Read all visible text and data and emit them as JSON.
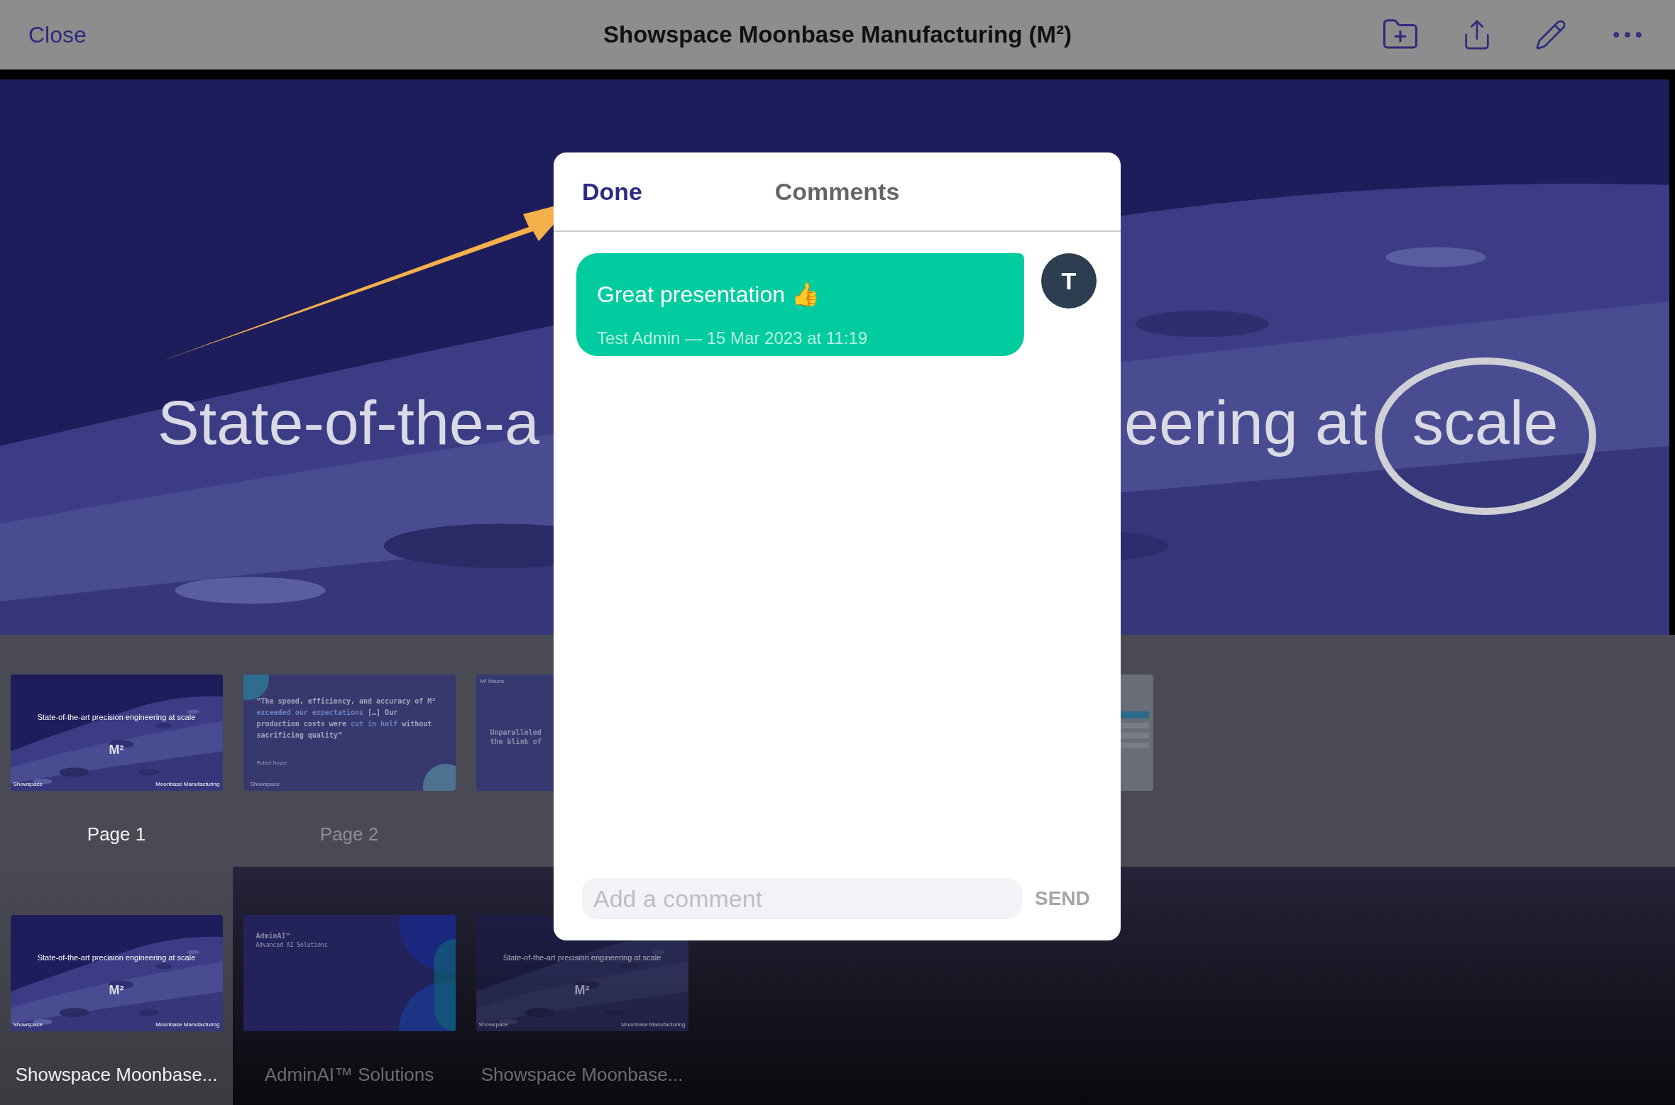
{
  "top_bar": {
    "close": "Close",
    "title": "Showspace Moonbase Manufacturing (M²)"
  },
  "slide": {
    "title_left": "State-of-the-a",
    "title_right": "eering at",
    "title_circled": "scale"
  },
  "pages": [
    {
      "label": "Page 1",
      "selected": true,
      "thumbnail": {
        "kind": "moon",
        "title": "State-of-the-art precision engineering at scale",
        "mark": "M²",
        "logo": "Showspace",
        "footer": "Moonbase Manufacturing"
      }
    },
    {
      "label": "Page 2",
      "selected": false,
      "thumbnail": {
        "kind": "quote",
        "quote": [
          {
            "text": "“The speed, efficiency, and accuracy of M² ",
            "highlight": false
          },
          {
            "text": "exceeded our expectations",
            "highlight": true
          },
          {
            "text": " […] Our production costs were ",
            "highlight": false
          },
          {
            "text": "cut in half",
            "highlight": true
          },
          {
            "text": " without sacrificing quality”",
            "highlight": false
          }
        ],
        "author": "Robert Noyce",
        "logo": "Showspace"
      }
    },
    {
      "thumbnail": {
        "kind": "macro",
        "heading": "M² Macro",
        "lines": [
          "Unparalleled",
          "the blink of"
        ]
      }
    }
  ],
  "documents": [
    {
      "label": "Showspace Moonbase...",
      "selected": true,
      "thumbnail": {
        "kind": "moon",
        "title": "State-of-the-art precision engineering at scale",
        "mark": "M²",
        "logo": "Showspace",
        "footer": "Moonbase Manufacturing"
      }
    },
    {
      "label": "AdminAI™ Solutions",
      "selected": false,
      "thumbnail": {
        "kind": "adminai",
        "heading": "AdminAI™",
        "subheading": "Advanced AI Solutions"
      }
    },
    {
      "label": "Showspace Moonbase...",
      "selected": false,
      "thumbnail": {
        "kind": "moon",
        "title": "State-of-the-art precision engineering at scale",
        "mark": "M²",
        "logo": "Showspace",
        "footer": "Moonbase Manufacturing"
      }
    }
  ],
  "comments_dialog": {
    "done": "Done",
    "title": "Comments",
    "comments": [
      {
        "text": "Great presentation 👍",
        "meta": "Test Admin — 15 Mar 2023 at 11:19",
        "avatar": "T"
      }
    ],
    "input": {
      "placeholder": "Add a comment"
    },
    "send": "SEND"
  }
}
